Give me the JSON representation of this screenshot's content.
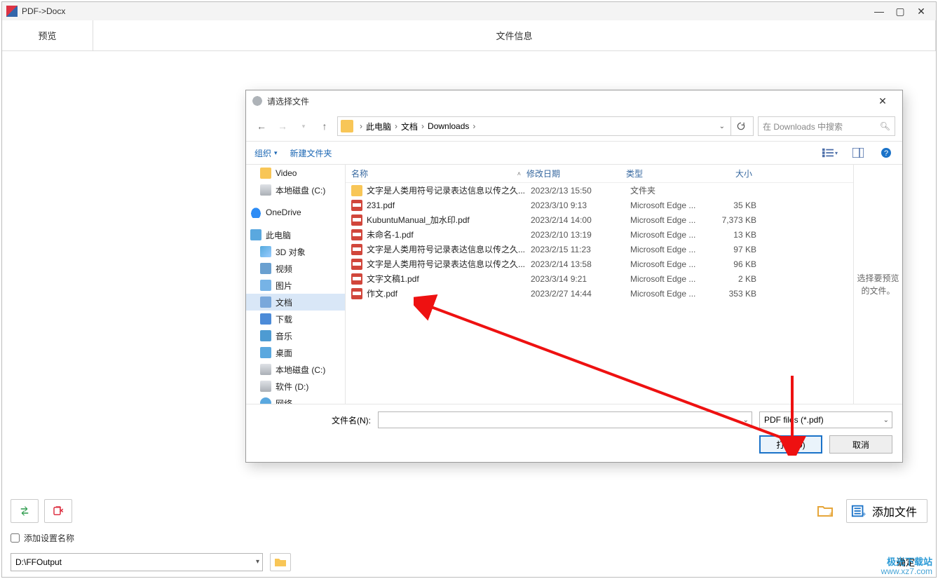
{
  "main": {
    "title": "PDF->Docx",
    "tabs": {
      "preview": "预览",
      "fileinfo": "文件信息"
    },
    "add_setting_label": "添加设置名称",
    "output_path": "D:\\FFOutput",
    "add_file_label": "添加文件",
    "ok_label": "确定"
  },
  "dialog": {
    "title": "请选择文件",
    "breadcrumb": {
      "root": "此电脑",
      "p1": "文档",
      "p2": "Downloads"
    },
    "search_placeholder": "在 Downloads 中搜索",
    "organize": "组织",
    "new_folder": "新建文件夹",
    "columns": {
      "name": "名称",
      "date": "修改日期",
      "type": "类型",
      "size": "大小"
    },
    "folder_type": "文件夹",
    "preview_hint": "选择要预览的文件。",
    "filename_label": "文件名(N):",
    "filter": "PDF files (*.pdf)",
    "open_btn": "打开(O)",
    "cancel_btn": "取消"
  },
  "tree": [
    {
      "icon": "folder",
      "label": "Video"
    },
    {
      "icon": "disk",
      "label": "本地磁盘 (C:)"
    },
    {
      "icon": "cloud",
      "label": "OneDrive"
    },
    {
      "icon": "monitor",
      "label": "此电脑"
    },
    {
      "icon": "obj3d",
      "label": "3D 对象"
    },
    {
      "icon": "video",
      "label": "视频"
    },
    {
      "icon": "pic",
      "label": "图片"
    },
    {
      "icon": "doc",
      "label": "文档",
      "selected": true
    },
    {
      "icon": "down",
      "label": "下载"
    },
    {
      "icon": "music",
      "label": "音乐"
    },
    {
      "icon": "desk",
      "label": "桌面"
    },
    {
      "icon": "disk",
      "label": "本地磁盘 (C:)"
    },
    {
      "icon": "disk",
      "label": "软件 (D:)"
    },
    {
      "icon": "net",
      "label": "网络"
    }
  ],
  "files": [
    {
      "icon": "folder",
      "name": "文字是人类用符号记录表达信息以传之久...",
      "date": "2023/2/13 15:50",
      "type": "文件夹",
      "size": ""
    },
    {
      "icon": "pdf",
      "name": "231.pdf",
      "date": "2023/3/10 9:13",
      "type": "Microsoft Edge ...",
      "size": "35 KB"
    },
    {
      "icon": "pdf",
      "name": "KubuntuManual_加水印.pdf",
      "date": "2023/2/14 14:00",
      "type": "Microsoft Edge ...",
      "size": "7,373 KB"
    },
    {
      "icon": "pdf",
      "name": "未命名-1.pdf",
      "date": "2023/2/10 13:19",
      "type": "Microsoft Edge ...",
      "size": "13 KB"
    },
    {
      "icon": "pdf",
      "name": "文字是人类用符号记录表达信息以传之久...",
      "date": "2023/2/15 11:23",
      "type": "Microsoft Edge ...",
      "size": "97 KB"
    },
    {
      "icon": "pdf",
      "name": "文字是人类用符号记录表达信息以传之久...",
      "date": "2023/2/14 13:58",
      "type": "Microsoft Edge ...",
      "size": "96 KB"
    },
    {
      "icon": "pdf",
      "name": "文字文稿1.pdf",
      "date": "2023/3/14 9:21",
      "type": "Microsoft Edge ...",
      "size": "2 KB"
    },
    {
      "icon": "pdf",
      "name": "作文.pdf",
      "date": "2023/2/27 14:44",
      "type": "Microsoft Edge ...",
      "size": "353 KB"
    }
  ],
  "watermark": {
    "brand": "极光下载站",
    "url": "www.xz7.com"
  }
}
